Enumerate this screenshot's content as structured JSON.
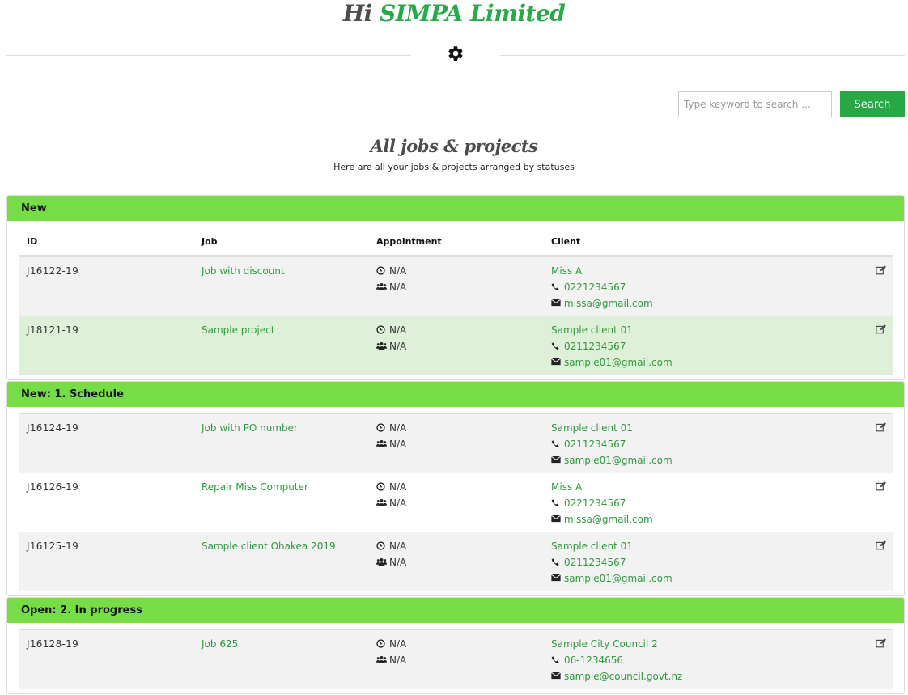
{
  "header": {
    "greeting": "Hi",
    "company": "SIMPA Limited"
  },
  "search": {
    "placeholder": "Type keyword to search ...",
    "button_label": "Search"
  },
  "page": {
    "title": "All jobs & projects",
    "subtitle": "Here are all your jobs & projects arranged by statuses"
  },
  "columns": {
    "id": "ID",
    "job": "Job",
    "appointment": "Appointment",
    "client": "Client"
  },
  "groups": [
    {
      "title": "New",
      "rows": [
        {
          "id": "J16122-19",
          "job": "Job with discount",
          "appt_time": "N/A",
          "appt_staff": "N/A",
          "client": "Miss A",
          "phone": "0221234567",
          "email": "missa@gmail.com"
        },
        {
          "id": "J18121-19",
          "job": "Sample project",
          "appt_time": "N/A",
          "appt_staff": "N/A",
          "client": "Sample client 01",
          "phone": "0211234567",
          "email": "sample01@gmail.com"
        }
      ]
    },
    {
      "title": "New: 1. Schedule",
      "rows": [
        {
          "id": "J16124-19",
          "job": "Job with PO number",
          "appt_time": "N/A",
          "appt_staff": "N/A",
          "client": "Sample client 01",
          "phone": "0211234567",
          "email": "sample01@gmail.com"
        },
        {
          "id": "J16126-19",
          "job": "Repair Miss Computer",
          "appt_time": "N/A",
          "appt_staff": "N/A",
          "client": "Miss A",
          "phone": "0221234567",
          "email": "missa@gmail.com"
        },
        {
          "id": "J16125-19",
          "job": "Sample client Ohakea 2019",
          "appt_time": "N/A",
          "appt_staff": "N/A",
          "client": "Sample client 01",
          "phone": "0211234567",
          "email": "sample01@gmail.com"
        }
      ]
    },
    {
      "title": "Open: 2. In progress",
      "rows": [
        {
          "id": "J16128-19",
          "job": "Job 625",
          "appt_time": "N/A",
          "appt_staff": "N/A",
          "client": "Sample City Council 2",
          "phone": "06-1234656",
          "email": "sample@council.govt.nz"
        }
      ]
    }
  ],
  "icons": {
    "settings": "gear-icon",
    "time": "clock-icon",
    "staff": "users-icon",
    "phone": "phone-icon",
    "email": "envelope-icon",
    "edit": "edit-icon"
  },
  "colors": {
    "accent": "#28a745",
    "group_header": "#77dd46",
    "link": "#2e9a3e",
    "row_odd": "#f2f2f2",
    "row_even": "#dff0d8"
  }
}
